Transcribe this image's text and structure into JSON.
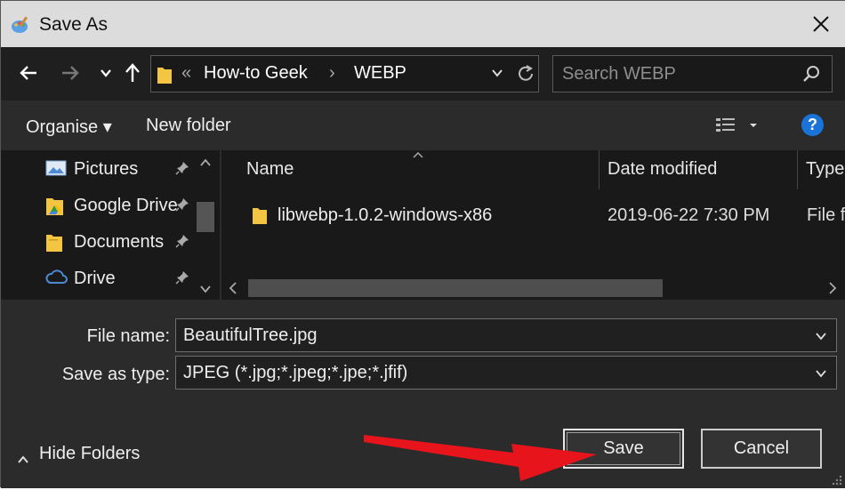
{
  "window": {
    "title": "Save As"
  },
  "address": {
    "overflow_marker": "«",
    "crumbs": [
      "How-to Geek",
      "WEBP"
    ],
    "separator": "›"
  },
  "search": {
    "placeholder": "Search WEBP"
  },
  "toolbar": {
    "organise_label": "Organise ▾",
    "new_folder_label": "New folder",
    "help_label": "?"
  },
  "sidebar": {
    "items": [
      {
        "label": "Pictures",
        "icon": "pictures-icon"
      },
      {
        "label": "Google Drive",
        "icon": "google-drive-icon"
      },
      {
        "label": "Documents",
        "icon": "folder-icon"
      },
      {
        "label": "Drive",
        "icon": "cloud-icon"
      }
    ]
  },
  "filelist": {
    "columns": [
      "Name",
      "Date modified",
      "Type"
    ],
    "rows": [
      {
        "name": "libwebp-1.0.2-windows-x86",
        "date": "2019-06-22 7:30 PM",
        "type": "File fo"
      }
    ]
  },
  "form": {
    "file_name_label": "File name:",
    "file_name_value": "BeautifulTree.jpg",
    "save_type_label": "Save as type:",
    "save_type_value": "JPEG (*.jpg;*.jpeg;*.jpe;*.jfif)"
  },
  "footer": {
    "hide_folders_label": "Hide Folders",
    "save_label": "Save",
    "cancel_label": "Cancel"
  },
  "colors": {
    "accent_blue": "#1a73d8",
    "arrow_red": "#e8141c",
    "folder_yellow": "#f4c542"
  }
}
